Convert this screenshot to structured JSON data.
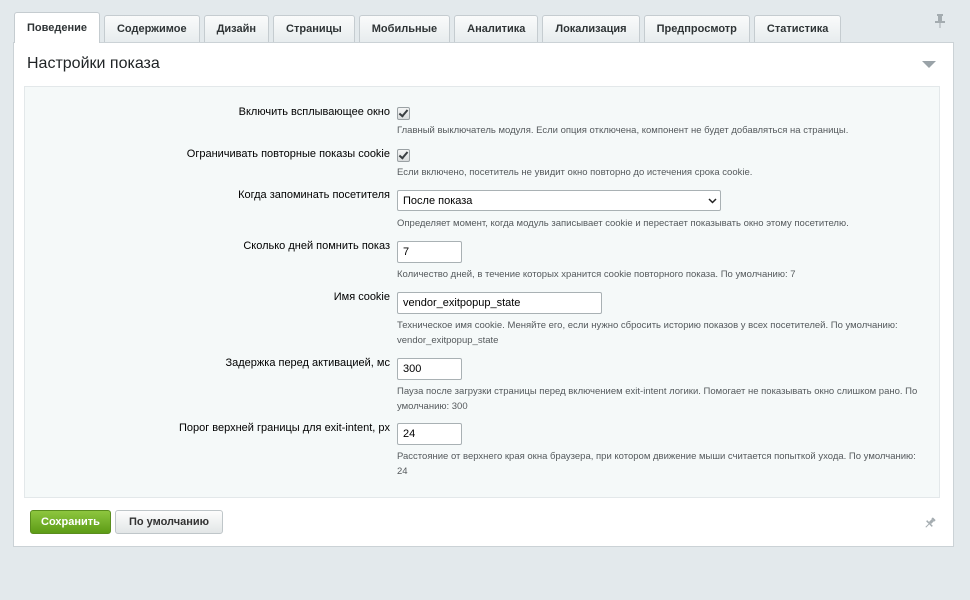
{
  "tabs": [
    {
      "label": "Поведение"
    },
    {
      "label": "Содержимое"
    },
    {
      "label": "Дизайн"
    },
    {
      "label": "Страницы"
    },
    {
      "label": "Мобильные"
    },
    {
      "label": "Аналитика"
    },
    {
      "label": "Локализация"
    },
    {
      "label": "Предпросмотр"
    },
    {
      "label": "Статистика"
    }
  ],
  "panel": {
    "title": "Настройки показа"
  },
  "fields": {
    "popup_enabled": {
      "label": "Включить всплывающее окно",
      "checked": true,
      "hint": "Главный выключатель модуля. Если опция отключена, компонент не будет добавляться на страницы."
    },
    "limit_repeats": {
      "label": "Ограничивать повторные показы cookie",
      "checked": true,
      "hint": "Если включено, посетитель не увидит окно повторно до истечения срока cookie."
    },
    "remember_when": {
      "label": "Когда запоминать посетителя",
      "value": "После показа",
      "hint": "Определяет момент, когда модуль записывает cookie и перестает показывать окно этому посетителю."
    },
    "remember_days": {
      "label": "Сколько дней помнить показ",
      "value": "7",
      "hint": "Количество дней, в течение которых хранится cookie повторного показа. По умолчанию: 7"
    },
    "cookie_name": {
      "label": "Имя cookie",
      "value": "vendor_exitpopup_state",
      "hint": "Техническое имя cookie. Меняйте его, если нужно сбросить историю показов у всех посетителей. По умолчанию: vendor_exitpopup_state"
    },
    "activation_delay": {
      "label": "Задержка перед активацией, мс",
      "value": "300",
      "hint": "Пауза после загрузки страницы перед включением exit-intent логики. Помогает не показывать окно слишком рано. По умолчанию: 300"
    },
    "top_threshold": {
      "label": "Порог верхней границы для exit-intent, px",
      "value": "24",
      "hint": "Расстояние от верхнего края окна браузера, при котором движение мыши считается попыткой ухода. По умолчанию: 24"
    }
  },
  "buttons": {
    "save": "Сохранить",
    "reset": "По умолчанию"
  },
  "colors": {
    "save_button": "#6aab20",
    "background": "#e3e9ec"
  }
}
